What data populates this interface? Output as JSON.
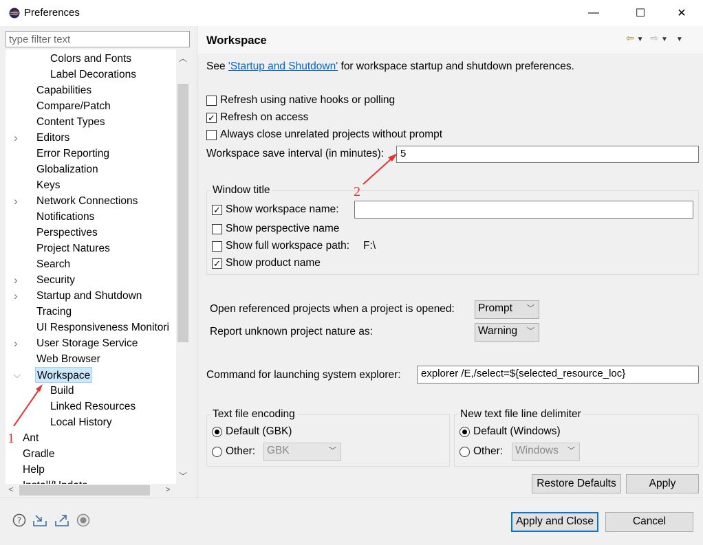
{
  "window": {
    "title": "Preferences",
    "minimize_glyph": "—",
    "maximize_glyph": "☐",
    "close_glyph": "✕"
  },
  "filter": {
    "placeholder": "type filter text"
  },
  "tree": {
    "items": [
      {
        "label": "Colors and Fonts",
        "level": 2,
        "expander": "",
        "selected": false
      },
      {
        "label": "Label Decorations",
        "level": 2,
        "expander": "",
        "selected": false
      },
      {
        "label": "Capabilities",
        "level": 1,
        "expander": "",
        "selected": false
      },
      {
        "label": "Compare/Patch",
        "level": 1,
        "expander": "",
        "selected": false
      },
      {
        "label": "Content Types",
        "level": 1,
        "expander": "",
        "selected": false
      },
      {
        "label": "Editors",
        "level": 1,
        "expander": ">",
        "selected": false
      },
      {
        "label": "Error Reporting",
        "level": 1,
        "expander": "",
        "selected": false
      },
      {
        "label": "Globalization",
        "level": 1,
        "expander": "",
        "selected": false
      },
      {
        "label": "Keys",
        "level": 1,
        "expander": "",
        "selected": false
      },
      {
        "label": "Network Connections",
        "level": 1,
        "expander": ">",
        "selected": false
      },
      {
        "label": "Notifications",
        "level": 1,
        "expander": "",
        "selected": false
      },
      {
        "label": "Perspectives",
        "level": 1,
        "expander": "",
        "selected": false
      },
      {
        "label": "Project Natures",
        "level": 1,
        "expander": "",
        "selected": false
      },
      {
        "label": "Search",
        "level": 1,
        "expander": "",
        "selected": false
      },
      {
        "label": "Security",
        "level": 1,
        "expander": ">",
        "selected": false
      },
      {
        "label": "Startup and Shutdown",
        "level": 1,
        "expander": ">",
        "selected": false
      },
      {
        "label": "Tracing",
        "level": 1,
        "expander": "",
        "selected": false
      },
      {
        "label": "UI Responsiveness Monitori",
        "level": 1,
        "expander": "",
        "selected": false
      },
      {
        "label": "User Storage Service",
        "level": 1,
        "expander": ">",
        "selected": false
      },
      {
        "label": "Web Browser",
        "level": 1,
        "expander": "",
        "selected": false
      },
      {
        "label": "Workspace",
        "level": 1,
        "expander": "v",
        "selected": true
      },
      {
        "label": "Build",
        "level": 2,
        "expander": "",
        "selected": false
      },
      {
        "label": "Linked Resources",
        "level": 2,
        "expander": "",
        "selected": false
      },
      {
        "label": "Local History",
        "level": 2,
        "expander": "",
        "selected": false
      },
      {
        "label": "Ant",
        "level": 0,
        "expander": ">",
        "selected": false
      },
      {
        "label": "Gradle",
        "level": 0,
        "expander": "",
        "selected": false
      },
      {
        "label": "Help",
        "level": 0,
        "expander": ">",
        "selected": false
      },
      {
        "label": "Install/Update",
        "level": 0,
        "expander": ">",
        "selected": false
      }
    ]
  },
  "page": {
    "title": "Workspace",
    "intro_prefix": "See ",
    "intro_link": "'Startup and Shutdown'",
    "intro_suffix": " for workspace startup and shutdown preferences.",
    "refresh_native": {
      "label": "Refresh using native hooks or polling",
      "checked": false
    },
    "refresh_access": {
      "label": "Refresh on access",
      "checked": true
    },
    "close_unrelated": {
      "label": "Always close unrelated projects without prompt",
      "checked": false
    },
    "save_interval": {
      "label": "Workspace save interval (in minutes):",
      "value": "5"
    },
    "window_title": {
      "group_label": "Window title",
      "show_ws_name": {
        "label": "Show workspace name:",
        "checked": true,
        "value": ""
      },
      "show_perspective": {
        "label": "Show perspective name",
        "checked": false
      },
      "show_full_path": {
        "label": "Show full workspace path:",
        "checked": false,
        "path": "F:\\"
      },
      "show_product": {
        "label": "Show product name",
        "checked": true
      }
    },
    "open_referenced": {
      "label": "Open referenced projects when a project is opened:",
      "value": "Prompt"
    },
    "unknown_nature": {
      "label": "Report unknown project nature as:",
      "value": "Warning"
    },
    "explorer_cmd": {
      "label": "Command for launching system explorer:",
      "value": "explorer /E,/select=${selected_resource_loc}"
    },
    "encoding": {
      "group_label": "Text file encoding",
      "default_label": "Default (GBK)",
      "other_label": "Other:",
      "other_value": "GBK",
      "default_selected": true
    },
    "line_delim": {
      "group_label": "New text file line delimiter",
      "default_label": "Default (Windows)",
      "other_label": "Other:",
      "other_value": "Windows",
      "default_selected": true
    },
    "restore_defaults": "Restore Defaults",
    "apply": "Apply"
  },
  "footer": {
    "apply_close": "Apply and Close",
    "cancel": "Cancel",
    "icons": [
      "help-icon",
      "import-icon",
      "export-icon",
      "record-icon"
    ]
  },
  "annotations": {
    "marker1": "1",
    "marker2": "2"
  },
  "colors": {
    "annotation": "#e53333",
    "selection": "#cce8ff",
    "link": "#0066cc",
    "default_button_border": "#0078d7"
  }
}
